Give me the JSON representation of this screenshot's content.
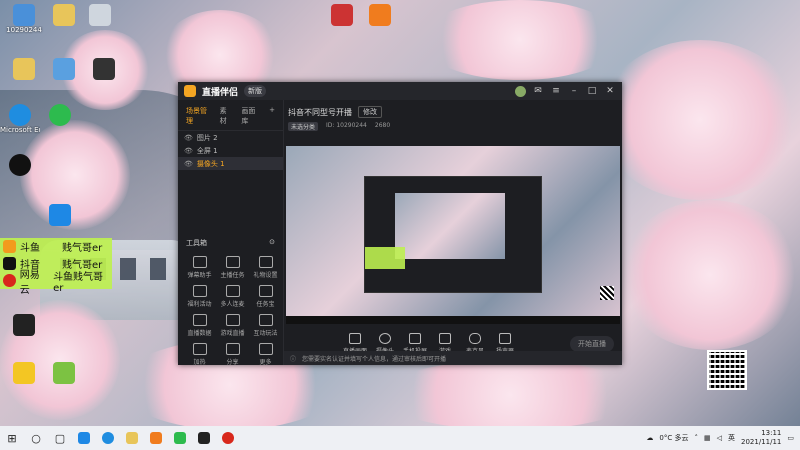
{
  "desktop": {
    "icons": [
      {
        "label": "10290244"
      },
      {
        "label": ""
      },
      {
        "label": ""
      },
      {
        "label": "Microsoft Edge"
      },
      {
        "label": ""
      },
      {
        "label": ""
      },
      {
        "label": ""
      }
    ],
    "overlay": [
      {
        "platform": "斗鱼",
        "name": "贱气哥er",
        "color": "#f29b1d"
      },
      {
        "platform": "抖音",
        "name": "贱气哥er",
        "color": "#111111"
      },
      {
        "platform": "网易云",
        "name": "斗鱼贱气哥er",
        "color": "#d8281c"
      }
    ]
  },
  "app": {
    "name": "直播伴侣",
    "version": "新版",
    "tabs": [
      "场景管理",
      "素材",
      "画面库"
    ],
    "sources": [
      {
        "label": "图片 2",
        "selected": false
      },
      {
        "label": "全屏 1",
        "selected": false
      },
      {
        "label": "摄像头 1",
        "selected": true
      }
    ],
    "tools_title": "工具箱",
    "tools": [
      "弹幕助手",
      "主播任务",
      "礼物设置",
      "福利活动",
      "多人连麦",
      "任务宝",
      "直播数据",
      "游戏直播",
      "互动玩法",
      "加热",
      "分享",
      "更多"
    ],
    "stream_title": "抖音不同型号开播",
    "edit_label": "修改",
    "meta": [
      "未选分类",
      "ID: 10290244",
      "2680"
    ],
    "bottom": [
      "直播画面",
      "摄像头",
      "手机投屏",
      "游戏",
      "麦克风",
      "扬声器"
    ],
    "start_label": "开始直播",
    "notice": "您需要实名认证并填写个人信息，通过审核后即可开播"
  },
  "taskbar": {
    "weather": "0°C 多云",
    "ime": "英",
    "time": "13:11",
    "date": "2021/11/11"
  }
}
